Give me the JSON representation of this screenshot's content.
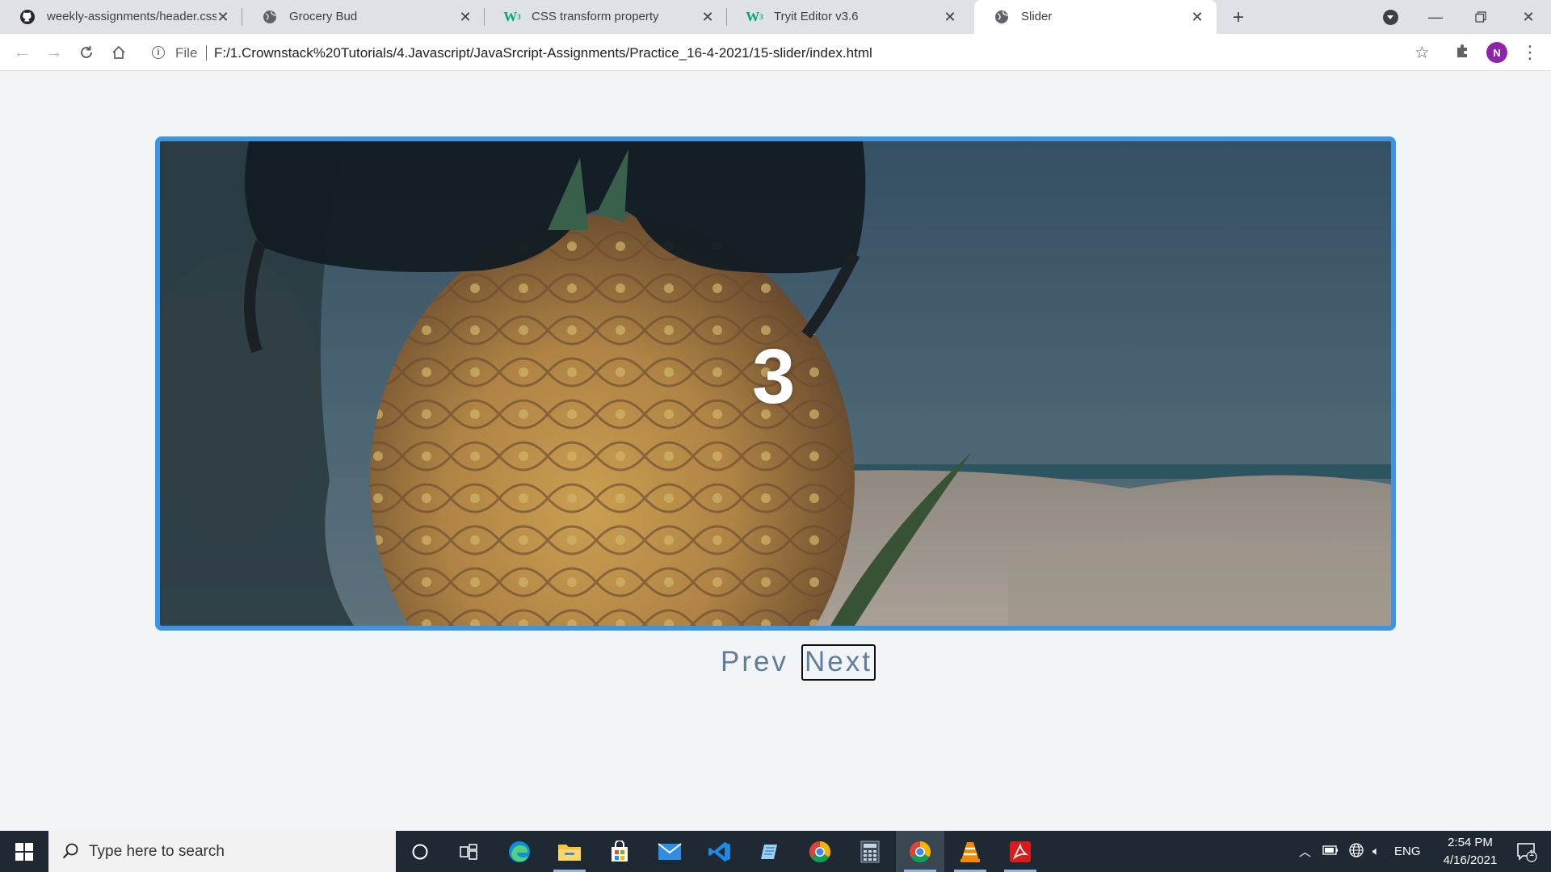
{
  "browser": {
    "tabs": [
      {
        "title": "weekly-assignments/header.css a",
        "favicon": "github-icon",
        "active": false
      },
      {
        "title": "Grocery Bud",
        "favicon": "globe-icon",
        "active": false
      },
      {
        "title": "CSS transform property",
        "favicon": "w3schools-icon",
        "active": false
      },
      {
        "title": "Tryit Editor v3.6",
        "favicon": "w3schools-icon",
        "active": false
      },
      {
        "title": "Slider",
        "favicon": "globe-icon",
        "active": true
      }
    ],
    "address": {
      "scheme": "File",
      "url": "F:/1.Crownstack%20Tutorials/4.Javascript/JavaSrcript-Assignments/Practice_16-4-2021/15-slider/index.html"
    },
    "profile_initial": "N",
    "accent_color": "#3b95e4"
  },
  "slider": {
    "current_slide": "3",
    "image": "pineapple-with-sunglasses-on-beach",
    "prev_label": "Prev",
    "next_label": "Next",
    "button_color": "#617d98"
  },
  "taskbar": {
    "search_placeholder": "Type here to search",
    "apps": [
      "cortana-icon",
      "task-view-icon",
      "edge-icon",
      "file-explorer-icon",
      "store-icon",
      "mail-icon",
      "vscode-icon",
      "notepad-icon",
      "chrome-icon",
      "calculator-icon",
      "chrome-icon",
      "vlc-icon",
      "acrobat-icon"
    ],
    "language": "ENG",
    "time": "2:54 PM",
    "date": "4/16/2021",
    "notification_count": "1"
  }
}
